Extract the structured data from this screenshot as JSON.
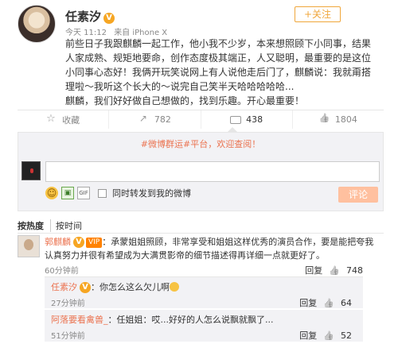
{
  "post": {
    "username": "任素汐",
    "verified_badge": "V",
    "follow_label": "+关注",
    "time": "今天 11:12",
    "source": "来自 iPhone X",
    "content": "前些日子我跟麒麟一起工作，他小我不少岁，本来想照顾下小同事，结果人家成熟、规矩地要命，创作态度极其端正，人又聪明，最重要的是这位小同事心态好！我俩开玩笑说网上有人说他走后门了，麒麟说：我就甭搭理啦～我听这个长大的～说完自己笑半天哈哈哈哈哈...\n麒麟，我们好好做自己想做的，找到乐趣。开心最重要！"
  },
  "actions": {
    "favorite": "收藏",
    "share": "782",
    "comment": "438",
    "like": "1804"
  },
  "comment_box": {
    "notice_prefix": "#微博群运#平台，",
    "notice_link": "欢迎查阅！",
    "input_placeholder": "",
    "repost_label": "同时转发到我的微博",
    "submit_label": "评论"
  },
  "sort": {
    "hot": "按热度",
    "time": "按时间"
  },
  "comments": [
    {
      "username": "郭麒麟",
      "vip": "VIP",
      "text": "：承蒙姐姐照顾，非常享受和姐姐这样优秀的演员合作，要是能把夸我认真努力并很有希望成为大满贯影帝的细节描述得再详细一点就更好了。",
      "time": "60分钟前",
      "reply_label": "回复",
      "likes": "748"
    }
  ],
  "replies": [
    {
      "username": "任素汐",
      "text": "：你怎么这么欠儿啊",
      "time": "27分钟前",
      "reply_label": "回复",
      "likes": "64"
    },
    {
      "username": "阿落要看禽兽_",
      "text": "：任姐姐：哎...好好的人怎么说飘就飘了...",
      "time": "51分钟前",
      "reply_label": "回复",
      "likes": "52"
    }
  ]
}
